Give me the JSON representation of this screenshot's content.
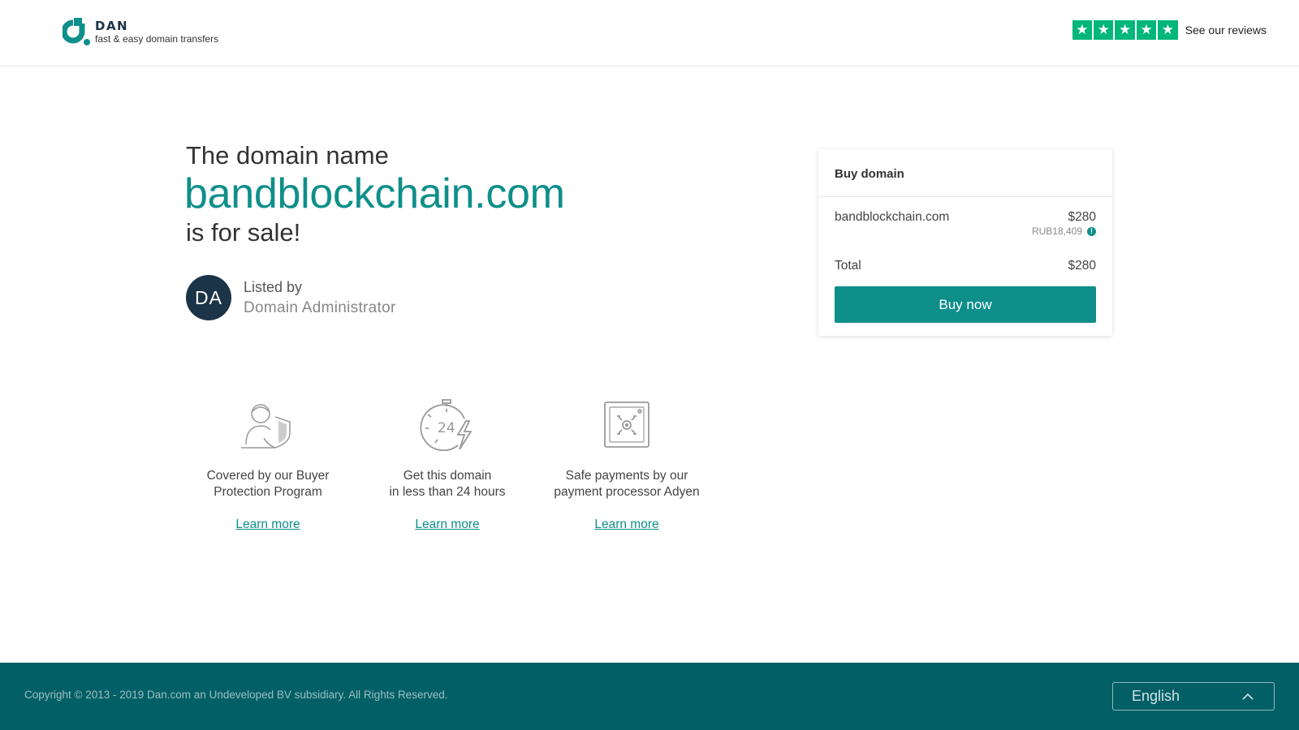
{
  "header": {
    "logo_name": "DAN",
    "logo_tagline": "fast & easy domain transfers",
    "reviews_label": "See our reviews",
    "trustpilot_color": "#00b67a",
    "star_count": 5
  },
  "hero": {
    "intro": "The domain name",
    "domain": "bandblockchain.com",
    "for_sale": "is for sale!"
  },
  "seller": {
    "initials": "DA",
    "listed_by_label": "Listed by",
    "name": "Domain Administrator"
  },
  "features": [
    {
      "icon": "buyer-protection-icon",
      "line1": "Covered by our Buyer",
      "line2": "Protection Program",
      "link": "Learn more"
    },
    {
      "icon": "24-hour-stopwatch-icon",
      "line1": "Get this domain",
      "line2": "in less than 24 hours",
      "link": "Learn more"
    },
    {
      "icon": "safe-payment-icon",
      "line1": "Safe payments by our",
      "line2": "payment processor Adyen",
      "link": "Learn more"
    }
  ],
  "card": {
    "title": "Buy domain",
    "domain": "bandblockchain.com",
    "price": "$280",
    "local_price": "RUB18,409",
    "total_label": "Total",
    "total": "$280",
    "buy_button": "Buy now"
  },
  "footer": {
    "copyright": "Copyright © 2013 - 2019 Dan.com an Undeveloped BV subsidiary. All Rights Reserved.",
    "language": "English"
  },
  "colors": {
    "accent": "#0e8f8a",
    "footer_bg": "#035f66",
    "navy": "#1c3448"
  }
}
